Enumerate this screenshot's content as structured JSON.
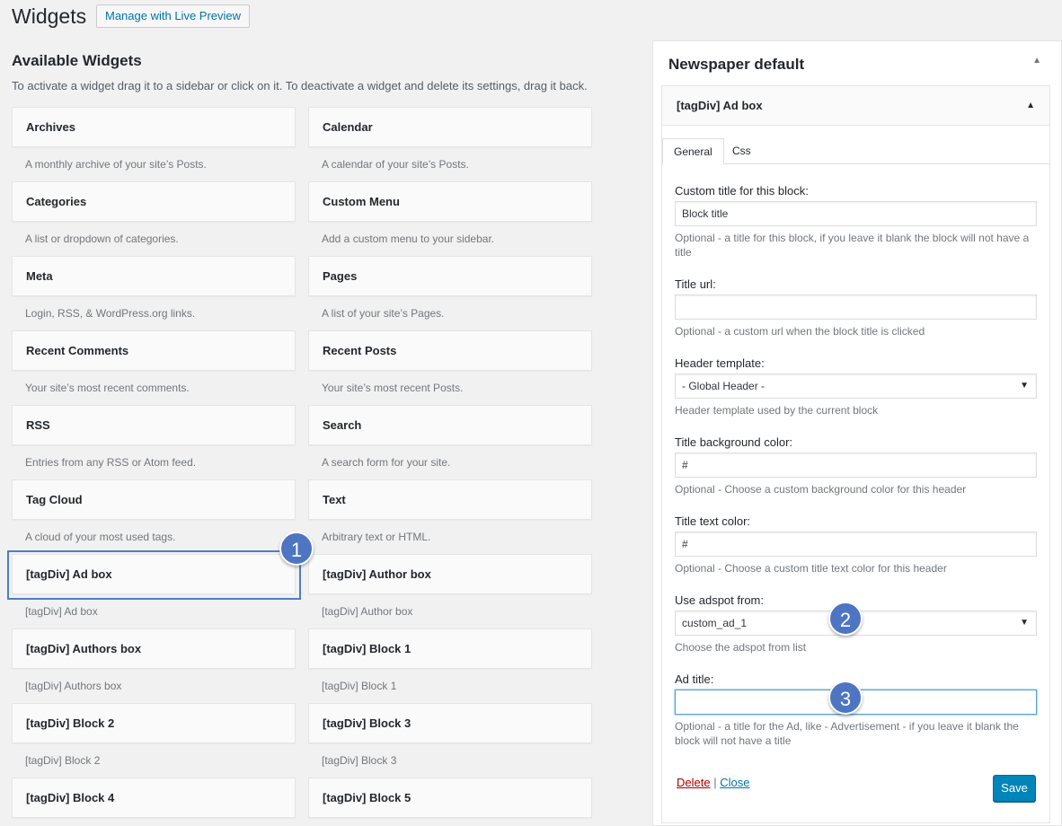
{
  "header": {
    "title": "Widgets",
    "live_preview_label": "Manage with Live Preview"
  },
  "available": {
    "title": "Available Widgets",
    "description": "To activate a widget drag it to a sidebar or click on it. To deactivate a widget and delete its settings, drag it back.",
    "widgets": [
      {
        "name": "Archives",
        "desc": "A monthly archive of your site’s Posts."
      },
      {
        "name": "Calendar",
        "desc": "A calendar of your site’s Posts."
      },
      {
        "name": "Categories",
        "desc": "A list or dropdown of categories."
      },
      {
        "name": "Custom Menu",
        "desc": "Add a custom menu to your sidebar."
      },
      {
        "name": "Meta",
        "desc": "Login, RSS, & WordPress.org links."
      },
      {
        "name": "Pages",
        "desc": "A list of your site’s Pages."
      },
      {
        "name": "Recent Comments",
        "desc": "Your site’s most recent comments."
      },
      {
        "name": "Recent Posts",
        "desc": "Your site’s most recent Posts."
      },
      {
        "name": "RSS",
        "desc": "Entries from any RSS or Atom feed."
      },
      {
        "name": "Search",
        "desc": "A search form for your site."
      },
      {
        "name": "Tag Cloud",
        "desc": "A cloud of your most used tags."
      },
      {
        "name": "Text",
        "desc": "Arbitrary text or HTML."
      },
      {
        "name": "[tagDiv] Ad box",
        "desc": "[tagDiv] Ad box"
      },
      {
        "name": "[tagDiv] Author box",
        "desc": "[tagDiv] Author box"
      },
      {
        "name": "[tagDiv] Authors box",
        "desc": "[tagDiv] Authors box"
      },
      {
        "name": "[tagDiv] Block 1",
        "desc": "[tagDiv] Block 1"
      },
      {
        "name": "[tagDiv] Block 2",
        "desc": "[tagDiv] Block 2"
      },
      {
        "name": "[tagDiv] Block 3",
        "desc": "[tagDiv] Block 3"
      },
      {
        "name": "[tagDiv] Block 4",
        "desc": ""
      },
      {
        "name": "[tagDiv] Block 5",
        "desc": ""
      }
    ]
  },
  "badges": {
    "one": "1",
    "two": "2",
    "three": "3"
  },
  "sidebar": {
    "title": "Newspaper default",
    "widget": {
      "title": "[tagDiv] Ad box",
      "tabs": {
        "general": "General",
        "css": "Css"
      },
      "custom_title": {
        "label": "Custom title for this block:",
        "value": "Block title",
        "help": "Optional - a title for this block, if you leave it blank the block will not have a title"
      },
      "title_url": {
        "label": "Title url:",
        "value": "",
        "help": "Optional - a custom url when the block title is clicked"
      },
      "header_template": {
        "label": "Header template:",
        "value": "- Global Header -",
        "help": "Header template used by the current block"
      },
      "title_bg_color": {
        "label": "Title background color:",
        "value": "#",
        "help": "Optional - Choose a custom background color for this header"
      },
      "title_text_color": {
        "label": "Title text color:",
        "value": "#",
        "help": "Optional - Choose a custom title text color for this header"
      },
      "adspot": {
        "label": "Use adspot from:",
        "value": "custom_ad_1",
        "help": "Choose the adspot from list"
      },
      "ad_title": {
        "label": "Ad title:",
        "value": "",
        "help": "Optional - a title for the Ad, like - Advertisement - if you leave it blank the block will not have a title"
      },
      "delete_label": "Delete",
      "separator": " | ",
      "close_label": "Close",
      "save_label": "Save"
    }
  },
  "colors": {
    "accent": "#0073aa",
    "save_button": "#0085ba",
    "badge": "#4d75c2",
    "highlight_border": "#4e7dc8",
    "delete_link": "#aa0000"
  }
}
